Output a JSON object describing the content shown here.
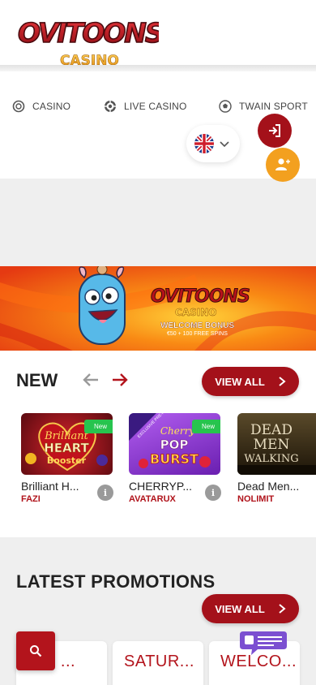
{
  "brand": {
    "logo_text": "OVITOONS",
    "logo_sub": "CASINO"
  },
  "nav": {
    "items": [
      {
        "label": "CASINO",
        "icon": "casino-chip-icon"
      },
      {
        "label": "LIVE CASINO",
        "icon": "live-casino-icon"
      },
      {
        "label": "TWAIN SPORT",
        "icon": "sport-ball-icon"
      }
    ],
    "language": {
      "flag": "uk-flag-icon",
      "selected": "English"
    },
    "login_icon": "login-icon",
    "register_icon": "add-user-icon"
  },
  "banner": {
    "title": "OVITOONS",
    "subtitle": "CASINO",
    "welcome": "WELCOME BONUS",
    "details": "€50 + 100 FREE SPINS"
  },
  "new_games": {
    "title": "NEW",
    "view_all": "VIEW ALL",
    "games": [
      {
        "name": "Brilliant H...",
        "provider": "FAZI",
        "badge": "New",
        "thumb_line1": "Brilliant",
        "thumb_line2": "HEART",
        "thumb_line3": "Booster"
      },
      {
        "name": "CHERRYP...",
        "provider": "AVATARUX",
        "badge": "New",
        "thumb_line1": "Cherry",
        "thumb_line2": "POP",
        "thumb_line3": "BURST",
        "ribbon": "EXCLUSIVE PRE-RELEASE"
      },
      {
        "name": "Dead Men...",
        "provider": "NOLIMIT",
        "badge": "",
        "thumb_line1": "DEAD",
        "thumb_line2": "MEN",
        "thumb_line3": "WALKING"
      }
    ],
    "info_label": "i"
  },
  "promotions": {
    "title": "LATEST PROMOTIONS",
    "view_all": "VIEW ALL",
    "cards": [
      {
        "label": "000 ..."
      },
      {
        "label": "SATUR..."
      },
      {
        "label": "WELCO..."
      }
    ]
  },
  "colors": {
    "brand_red": "#a4111a",
    "brand_orange": "#f3a01f",
    "provider_red": "#b0131b",
    "badge_green": "#27c44e",
    "chat_purple": "#7b4fd1"
  }
}
